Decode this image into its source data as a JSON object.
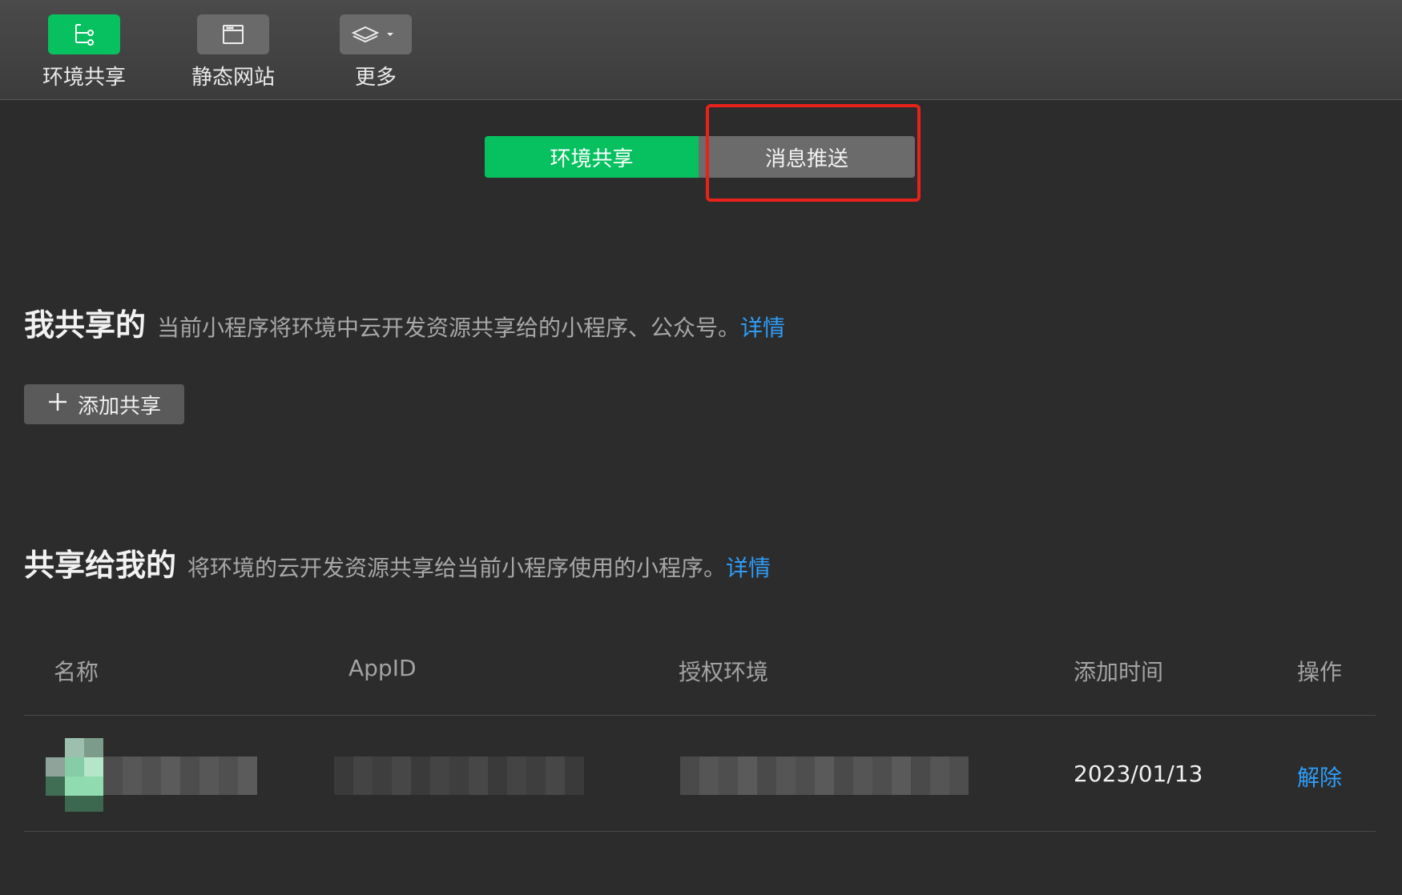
{
  "toolbar": {
    "items": [
      {
        "label": "环境共享",
        "icon": "tree-share-icon",
        "active": true
      },
      {
        "label": "静态网站",
        "icon": "browser-window-icon",
        "active": false
      },
      {
        "label": "更多",
        "icon": "layers-icon",
        "active": false
      }
    ]
  },
  "tabs": [
    {
      "label": "环境共享",
      "selected": true
    },
    {
      "label": "消息推送",
      "selected": false
    }
  ],
  "my_shares": {
    "title": "我共享的",
    "description": "当前小程序将环境中云开发资源共享给的小程序、公众号。",
    "link": "详情",
    "add_button": "添加共享"
  },
  "shared_to_me": {
    "title": "共享给我的",
    "description": "将环境的云开发资源共享给当前小程序使用的小程序。",
    "link": "详情"
  },
  "table": {
    "columns": [
      "名称",
      "AppID",
      "授权环境",
      "添加时间",
      "操作"
    ],
    "rows": [
      {
        "date": "2023/01/13",
        "action": "解除"
      }
    ]
  },
  "colors": {
    "accent_green": "#07c160",
    "link_blue": "#2f9cf6",
    "highlight_red": "#e8221b",
    "background": "#2c2c2c"
  }
}
